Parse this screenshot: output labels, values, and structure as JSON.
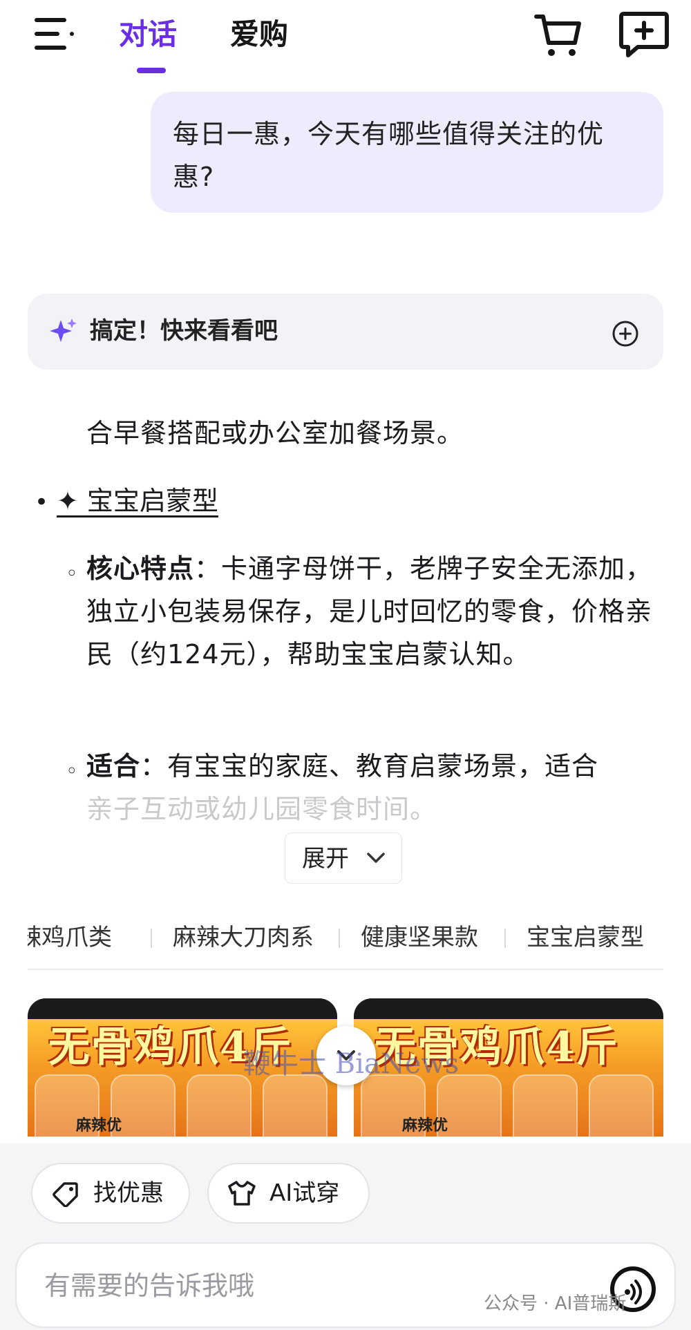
{
  "header": {
    "tabs": [
      {
        "label": "对话",
        "active": true
      },
      {
        "label": "爱购",
        "active": false
      }
    ],
    "accent_color": "#6a2ee6"
  },
  "conversation": {
    "user_message": "每日一惠，今天有哪些值得关注的优惠?",
    "status_card": {
      "text": "搞定！快来看看吧"
    },
    "answer": {
      "intro_line": "合早餐搭配或办公室加餐场景。",
      "section": {
        "title": "✦ 宝宝启蒙型",
        "points": [
          {
            "label": "核心特点",
            "sep": "：",
            "text": "卡通字母饼干，老牌子安全无添加，独立小包装易保存，是儿时回忆的零食，价格亲民（约124元），帮助宝宝启蒙认知。"
          },
          {
            "label": "适合",
            "sep": "：",
            "text": "有宝宝的家庭、教育启蒙场景，适合"
          },
          {
            "label": "",
            "sep": "",
            "text": "亲子互动或幼儿园零食时间。"
          }
        ]
      },
      "expand_label": "展开"
    },
    "categories": [
      "辣鸡爪类",
      "麻辣大刀肉系",
      "健康坚果款",
      "宝宝启蒙型"
    ],
    "products": [
      {
        "title": "无骨鸡爪4斤",
        "brand": "麻辣优"
      },
      {
        "title": "无骨鸡爪4斤",
        "brand": "麻辣优"
      }
    ],
    "overlay_watermark": "鞭牛士 BiaNews"
  },
  "composer": {
    "chips": [
      {
        "label": "找优惠",
        "icon": "price-tag-icon"
      },
      {
        "label": "AI试穿",
        "icon": "tshirt-icon"
      }
    ],
    "input_placeholder": "有需要的告诉我哦"
  },
  "footer_watermark": "公众号 · AI普瑞斯"
}
